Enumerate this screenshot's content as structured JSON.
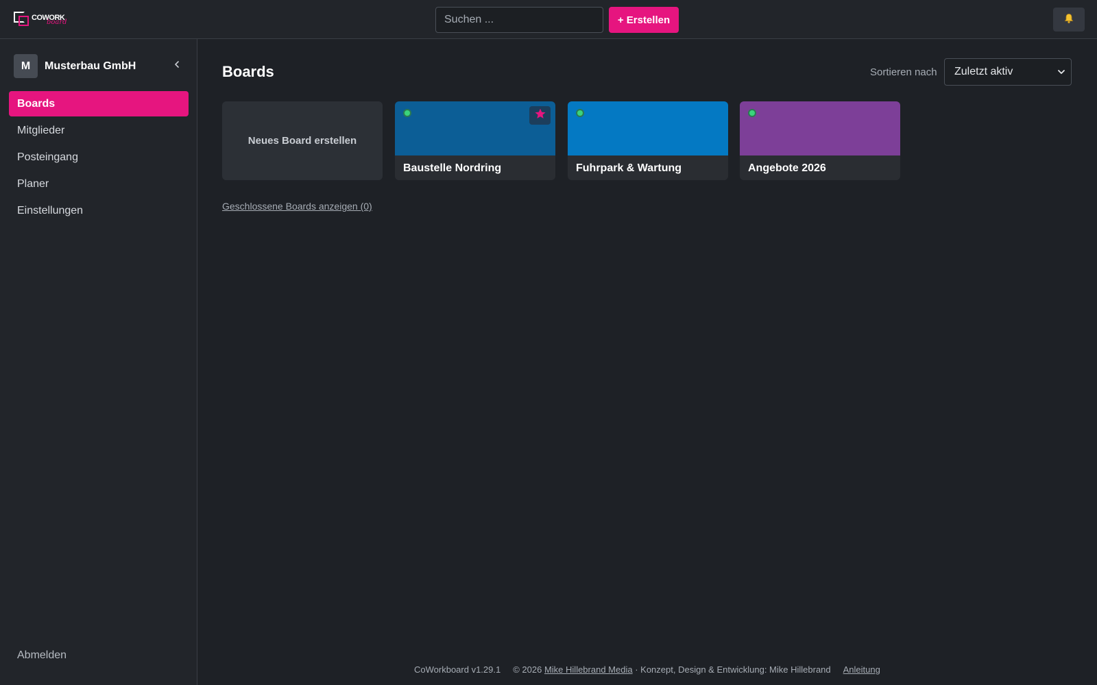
{
  "app": {
    "logo_word": "COWORK",
    "logo_script": "board"
  },
  "header": {
    "search_placeholder": "Suchen ...",
    "create_label": "+ Erstellen",
    "bell_icon": "bell-icon"
  },
  "sidebar": {
    "org_initial": "M",
    "org_name": "Musterbau GmbH",
    "collapse_icon": "chevron-left-icon",
    "items": [
      {
        "label": "Boards",
        "active": true
      },
      {
        "label": "Mitglieder",
        "active": false
      },
      {
        "label": "Posteingang",
        "active": false
      },
      {
        "label": "Planer",
        "active": false
      },
      {
        "label": "Einstellungen",
        "active": false
      }
    ],
    "logout_label": "Abmelden"
  },
  "main": {
    "title": "Boards",
    "sort_label": "Sortieren nach",
    "sort_value": "Zuletzt aktiv",
    "new_board_label": "Neues Board erstellen",
    "boards": [
      {
        "name": "Baustelle Nordring",
        "color": "#0c5e96",
        "starred": true
      },
      {
        "name": "Fuhrpark & Wartung",
        "color": "#0479c3",
        "starred": false
      },
      {
        "name": "Angebote 2026",
        "color": "#7d3f98",
        "starred": false
      }
    ],
    "closed_boards_link": "Geschlossene Boards anzeigen (0)"
  },
  "colors": {
    "accent": "#e6157f",
    "status_dot": "#3bd47c"
  },
  "footer": {
    "version": "CoWorkboard v1.29.1",
    "copyright": "© 2026",
    "company_link": "Mike Hillebrand Media",
    "credit": "· Konzept, Design & Entwicklung: Mike Hillebrand",
    "guide_link": "Anleitung"
  }
}
